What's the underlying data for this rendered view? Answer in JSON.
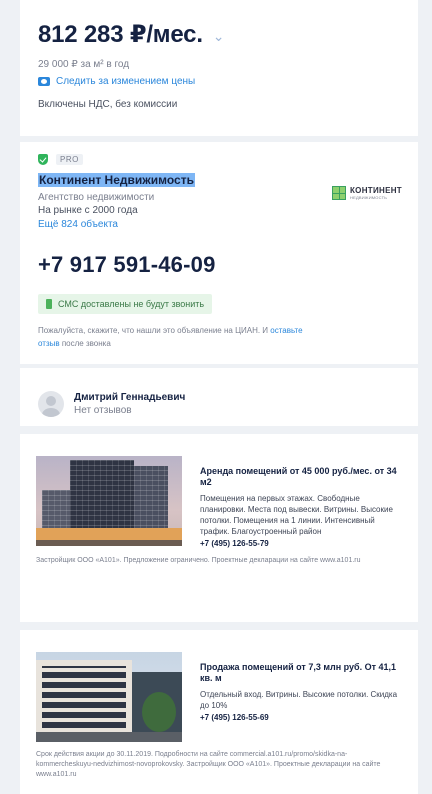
{
  "price_card": {
    "price": "812 283 ₽/мес.",
    "per_m2": "29 000 ₽ за м² в год",
    "follow_price": "Следить за изменением цены",
    "vat": "Включены НДС, без комиссии"
  },
  "agency": {
    "badge": "PRO",
    "name": "Континент Недвижимость",
    "type": "Агентство недвижимости",
    "since": "На рынке с 2000 года",
    "objects_link": "Ещё 824 объекта",
    "logo_title": "КОНТИНЕНТ",
    "logo_subtitle": "НЕДВИЖИМОСТЬ",
    "phone": "+7 917 591-46-09",
    "sms_note": "СМС доставлены не будут звонить",
    "note_text": "Пожалуйста, скажите, что нашли это объявление на ЦИАН. И",
    "note_link": "оставьте отзыв",
    "note_tail": "после звонка"
  },
  "contact": {
    "name": "Дмитрий Геннадьевич",
    "reviews": "Нет отзывов"
  },
  "ads": [
    {
      "title": "Аренда помещений от 45 000 руб./мес. от 34 м2",
      "description": "Помещения на первых этажах. Свободные планировки. Места под вывески. Витрины. Высокие потолки. Помещения на 1 линии. Интенсивный трафик. Благоустроенный район",
      "phone": "+7 (495) 126-55-79",
      "footer": "Застройщик ООО «А101». Предложение ограничено. Проектные декларации на сайте www.a101.ru"
    },
    {
      "title": "Продажа помещений от 7,3 млн руб. От 41,1 кв. м",
      "description": "Отдельный вход. Витрины. Высокие потолки. Скидка до 10%",
      "phone": "+7 (495) 126-55-69",
      "footer": "Срок действия акции до 30.11.2019. Подробности на сайте commercial.a101.ru/promo/skidka-na-kommercheskuyu-nedvizhimost-novoprokovsky. Застройщик ООО «А101». Проектные декларации на сайте www.a101.ru"
    }
  ],
  "colors": {
    "accent_blue": "#2b87db",
    "text_dark": "#152242",
    "pro_green": "#2fb45b",
    "selection_blue": "#7eb6f5",
    "background": "#eef1f5"
  }
}
